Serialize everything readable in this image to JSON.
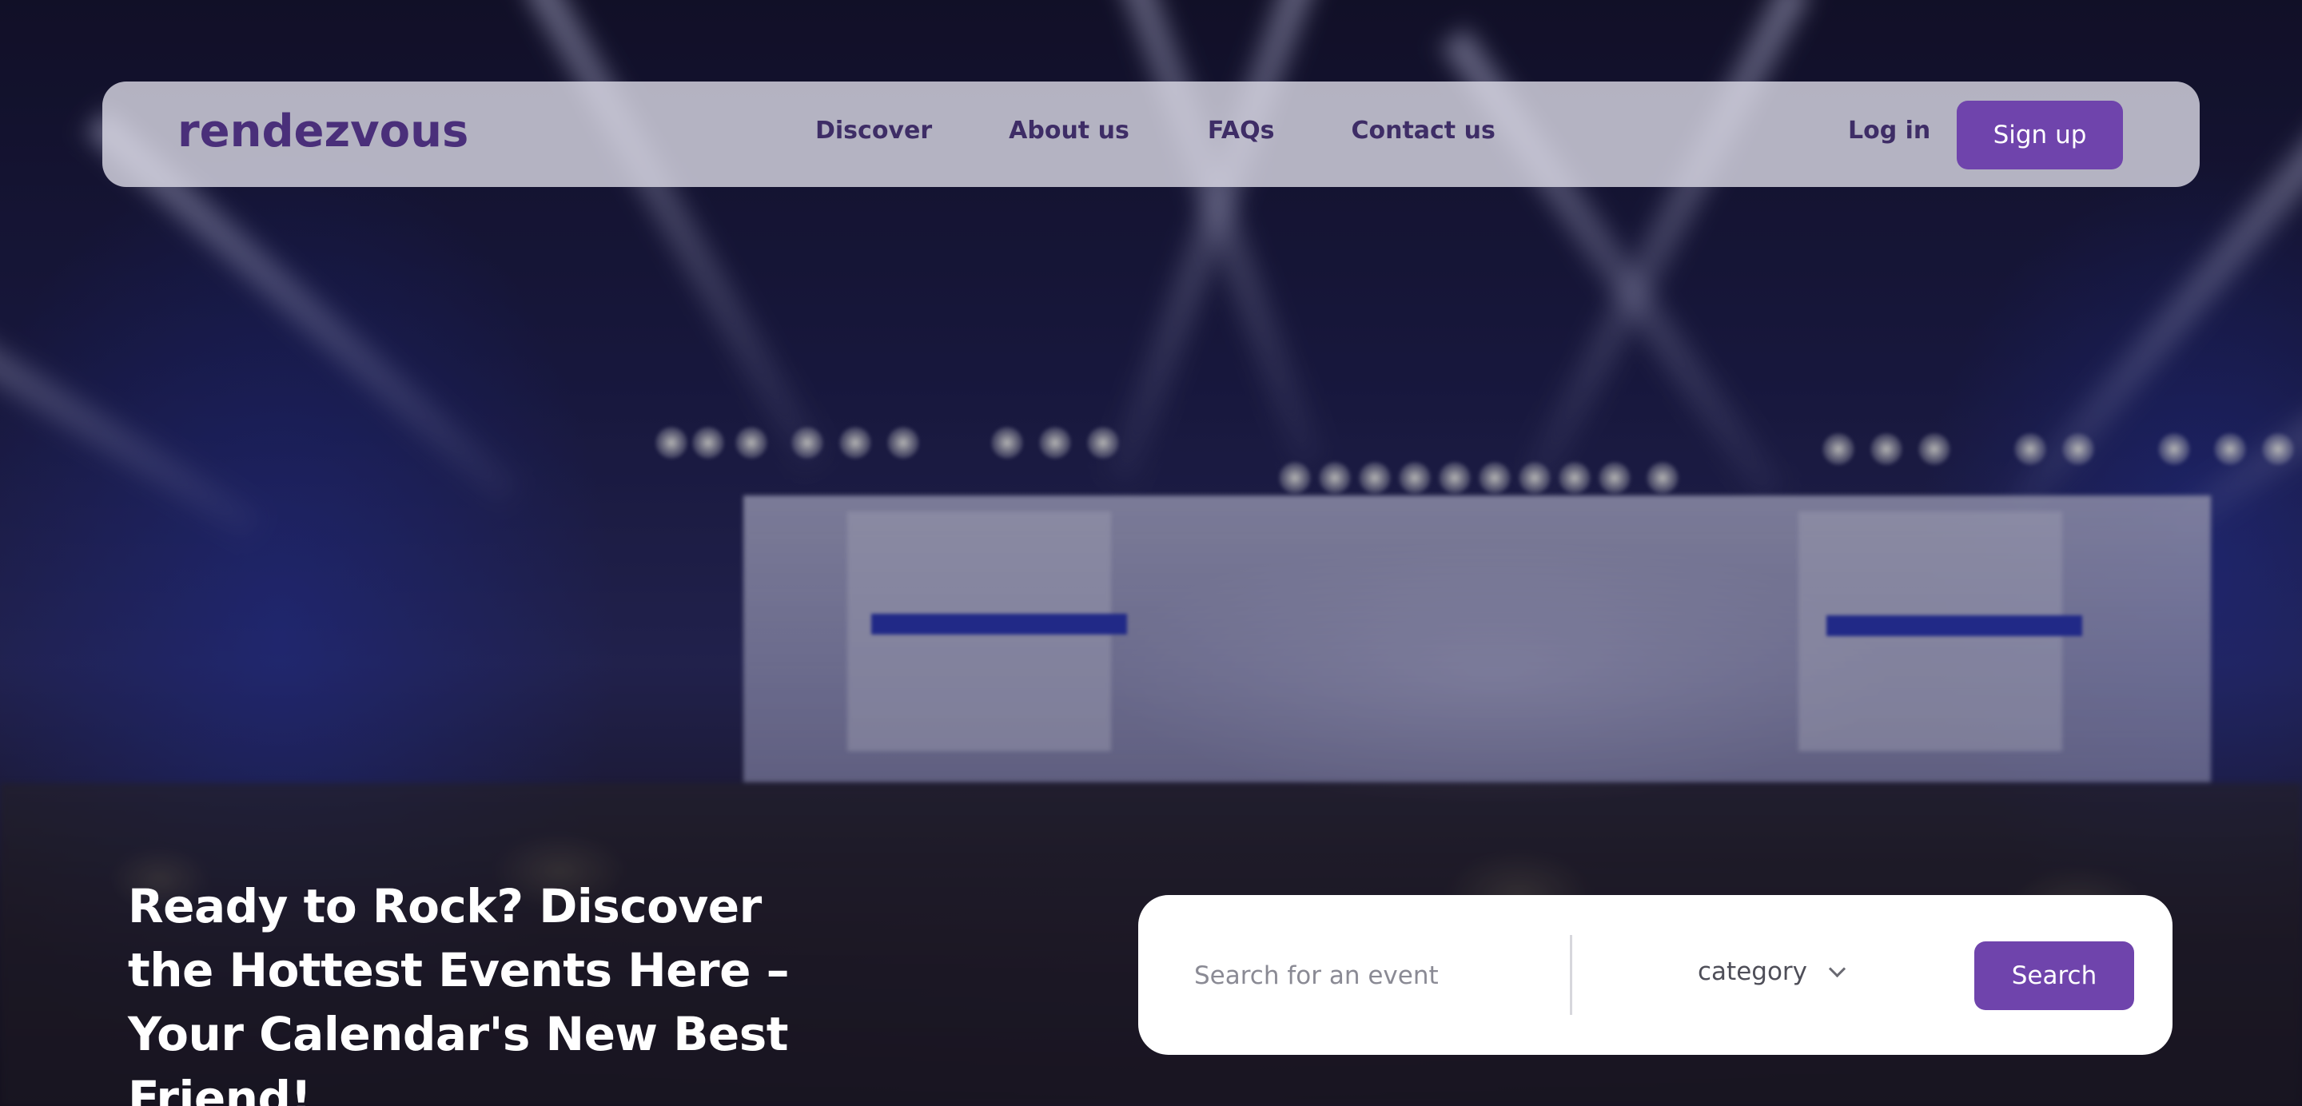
{
  "brand": {
    "name": "rendezvous",
    "color": "#4a2f7a"
  },
  "nav": {
    "links": [
      {
        "label": "Discover"
      },
      {
        "label": "About us"
      },
      {
        "label": "FAQs"
      },
      {
        "label": "Contact us"
      }
    ],
    "login_label": "Log in",
    "signup_label": "Sign up"
  },
  "hero": {
    "headline": "Ready to Rock? Discover the Hottest Events Here – Your Calendar's New Best Friend!"
  },
  "search": {
    "placeholder": "Search for an event",
    "value": "",
    "category_label": "category",
    "button_label": "Search"
  },
  "colors": {
    "accent": "#6f44ac",
    "nav_text": "#3e2d66",
    "background_image": "blurred concert stage with light beams"
  }
}
